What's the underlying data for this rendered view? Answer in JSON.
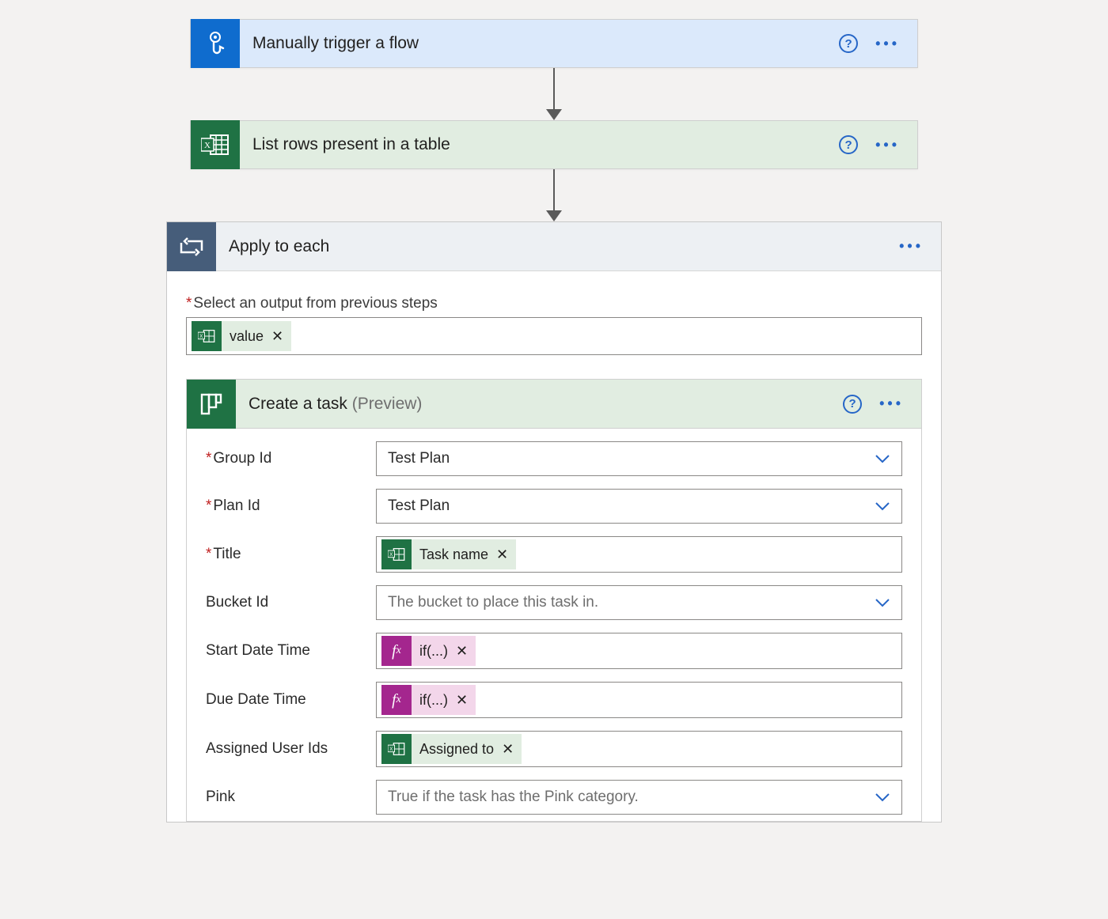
{
  "steps": {
    "trigger": {
      "title": "Manually trigger a flow"
    },
    "excel": {
      "title": "List rows present in a table"
    },
    "apply": {
      "title": "Apply to each"
    },
    "select_output_label": "Select an output from previous steps",
    "value_token": "value",
    "create": {
      "title": "Create a task ",
      "suffix": "(Preview)"
    }
  },
  "form": {
    "group_id": {
      "label": "Group Id",
      "value": "Test Plan",
      "required": true
    },
    "plan_id": {
      "label": "Plan Id",
      "value": "Test Plan",
      "required": true
    },
    "title": {
      "label": "Title",
      "token": "Task name",
      "required": true
    },
    "bucket_id": {
      "label": "Bucket Id",
      "placeholder": "The bucket to place this task in."
    },
    "start_dt": {
      "label": "Start Date Time",
      "fx": "if(...)"
    },
    "due_dt": {
      "label": "Due Date Time",
      "fx": "if(...)"
    },
    "assigned": {
      "label": "Assigned User Ids",
      "token": "Assigned to"
    },
    "pink": {
      "label": "Pink",
      "placeholder": "True if the task has the Pink category."
    }
  }
}
